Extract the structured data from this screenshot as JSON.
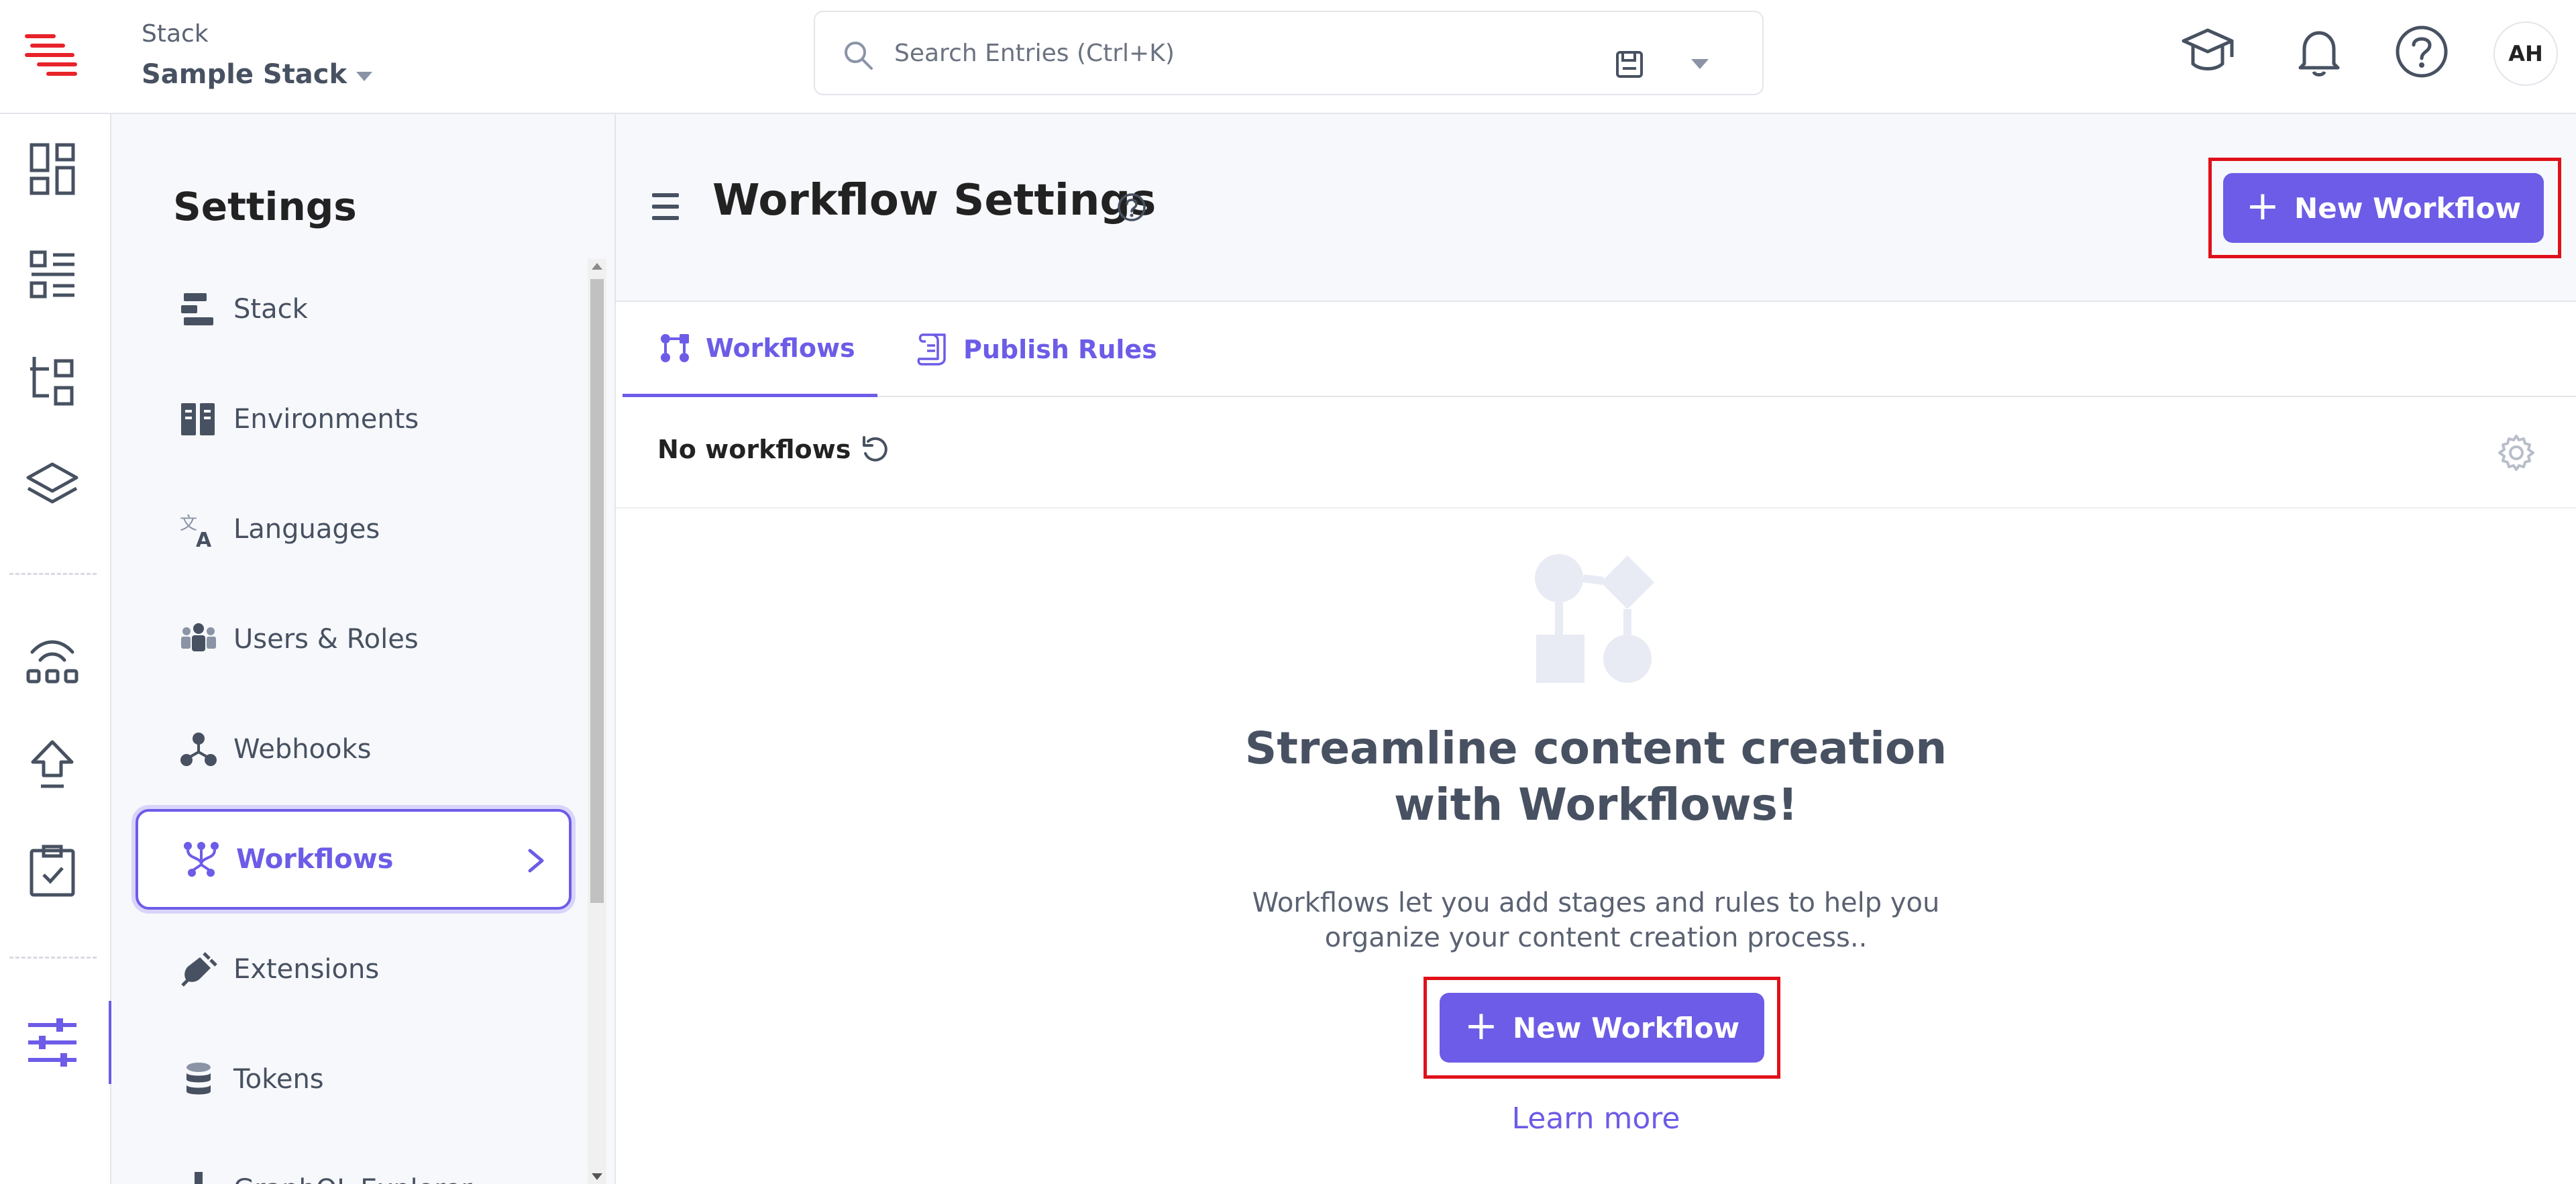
{
  "header": {
    "stack_label": "Stack",
    "stack_name": "Sample Stack",
    "search_placeholder": "Search Entries (Ctrl+K)",
    "avatar_initials": "AH"
  },
  "settings": {
    "title": "Settings",
    "items": [
      {
        "label": "Stack",
        "icon": "stack-icon"
      },
      {
        "label": "Environments",
        "icon": "environments-icon"
      },
      {
        "label": "Languages",
        "icon": "languages-icon"
      },
      {
        "label": "Users & Roles",
        "icon": "users-roles-icon"
      },
      {
        "label": "Webhooks",
        "icon": "webhooks-icon"
      },
      {
        "label": "Workflows",
        "icon": "workflows-icon",
        "active": true
      },
      {
        "label": "Extensions",
        "icon": "extensions-icon"
      },
      {
        "label": "Tokens",
        "icon": "tokens-icon"
      },
      {
        "label": "GraphQL Explorer",
        "icon": "graphql-icon"
      }
    ]
  },
  "main": {
    "title": "Workflow Settings",
    "new_workflow_label": "New Workflow",
    "tabs": [
      {
        "label": "Workflows",
        "active": true
      },
      {
        "label": "Publish Rules",
        "active": false
      }
    ],
    "list_title": "No workflows",
    "empty_title": "Streamline content creation with Workflows!",
    "empty_desc": "Workflows let you add stages and rules to help you organize your content creation process..",
    "learn_more": "Learn more"
  },
  "colors": {
    "accent": "#6c5ce7",
    "highlight": "#e0101a",
    "brand": "#e8232a"
  }
}
